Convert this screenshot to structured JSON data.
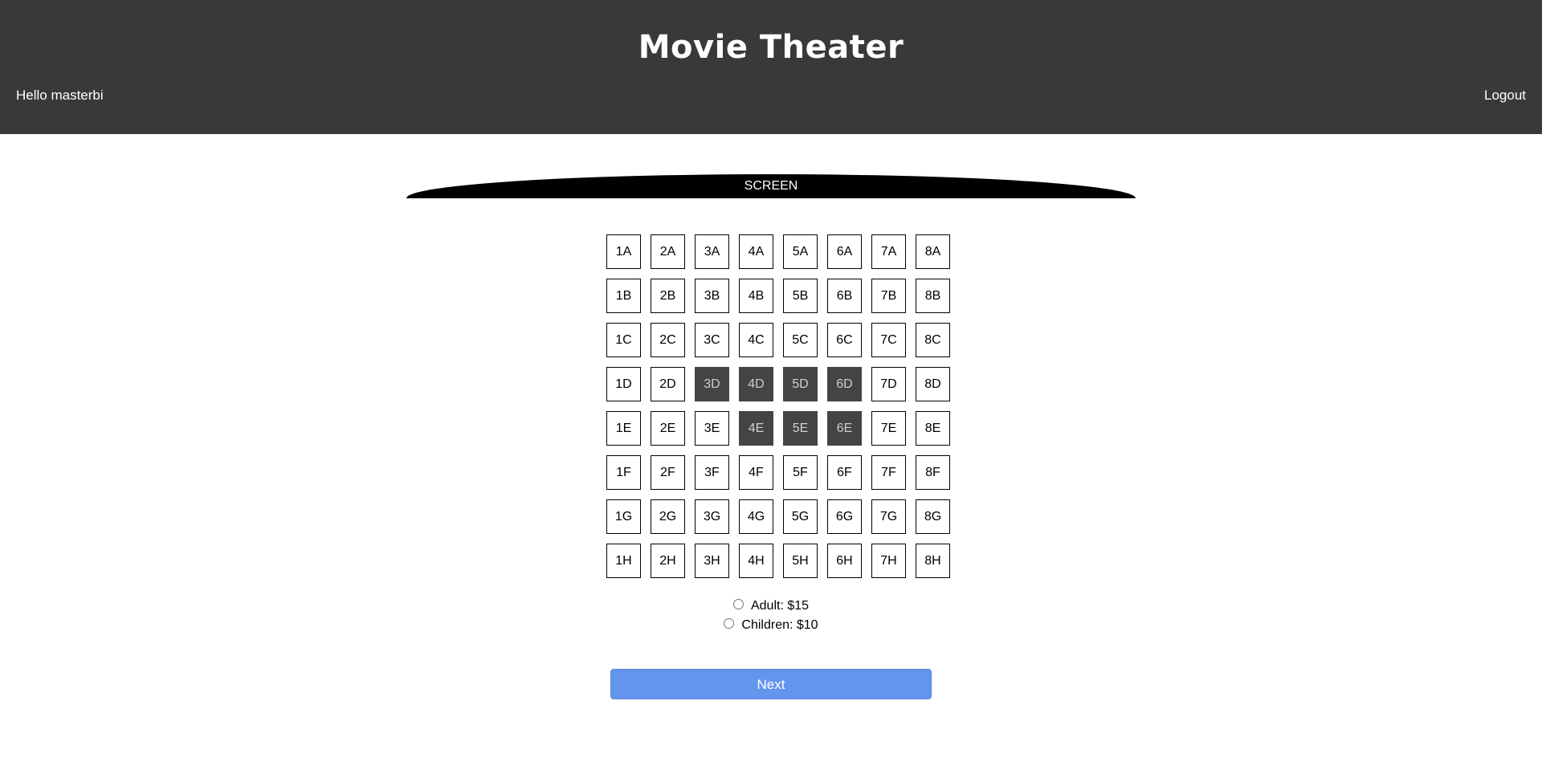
{
  "header": {
    "title": "Movie Theater",
    "greeting": "Hello masterbi",
    "logout_label": "Logout"
  },
  "screen_label": "SCREEN",
  "seats": [
    {
      "label": "1A",
      "taken": false
    },
    {
      "label": "2A",
      "taken": false
    },
    {
      "label": "3A",
      "taken": false
    },
    {
      "label": "4A",
      "taken": false
    },
    {
      "label": "5A",
      "taken": false
    },
    {
      "label": "6A",
      "taken": false
    },
    {
      "label": "7A",
      "taken": false
    },
    {
      "label": "8A",
      "taken": false
    },
    {
      "label": "1B",
      "taken": false
    },
    {
      "label": "2B",
      "taken": false
    },
    {
      "label": "3B",
      "taken": false
    },
    {
      "label": "4B",
      "taken": false
    },
    {
      "label": "5B",
      "taken": false
    },
    {
      "label": "6B",
      "taken": false
    },
    {
      "label": "7B",
      "taken": false
    },
    {
      "label": "8B",
      "taken": false
    },
    {
      "label": "1C",
      "taken": false
    },
    {
      "label": "2C",
      "taken": false
    },
    {
      "label": "3C",
      "taken": false
    },
    {
      "label": "4C",
      "taken": false
    },
    {
      "label": "5C",
      "taken": false
    },
    {
      "label": "6C",
      "taken": false
    },
    {
      "label": "7C",
      "taken": false
    },
    {
      "label": "8C",
      "taken": false
    },
    {
      "label": "1D",
      "taken": false
    },
    {
      "label": "2D",
      "taken": false
    },
    {
      "label": "3D",
      "taken": true
    },
    {
      "label": "4D",
      "taken": true
    },
    {
      "label": "5D",
      "taken": true
    },
    {
      "label": "6D",
      "taken": true
    },
    {
      "label": "7D",
      "taken": false
    },
    {
      "label": "8D",
      "taken": false
    },
    {
      "label": "1E",
      "taken": false
    },
    {
      "label": "2E",
      "taken": false
    },
    {
      "label": "3E",
      "taken": false
    },
    {
      "label": "4E",
      "taken": true
    },
    {
      "label": "5E",
      "taken": true
    },
    {
      "label": "6E",
      "taken": true
    },
    {
      "label": "7E",
      "taken": false
    },
    {
      "label": "8E",
      "taken": false
    },
    {
      "label": "1F",
      "taken": false
    },
    {
      "label": "2F",
      "taken": false
    },
    {
      "label": "3F",
      "taken": false
    },
    {
      "label": "4F",
      "taken": false
    },
    {
      "label": "5F",
      "taken": false
    },
    {
      "label": "6F",
      "taken": false
    },
    {
      "label": "7F",
      "taken": false
    },
    {
      "label": "8F",
      "taken": false
    },
    {
      "label": "1G",
      "taken": false
    },
    {
      "label": "2G",
      "taken": false
    },
    {
      "label": "3G",
      "taken": false
    },
    {
      "label": "4G",
      "taken": false
    },
    {
      "label": "5G",
      "taken": false
    },
    {
      "label": "6G",
      "taken": false
    },
    {
      "label": "7G",
      "taken": false
    },
    {
      "label": "8G",
      "taken": false
    },
    {
      "label": "1H",
      "taken": false
    },
    {
      "label": "2H",
      "taken": false
    },
    {
      "label": "3H",
      "taken": false
    },
    {
      "label": "4H",
      "taken": false
    },
    {
      "label": "5H",
      "taken": false
    },
    {
      "label": "6H",
      "taken": false
    },
    {
      "label": "7H",
      "taken": false
    },
    {
      "label": "8H",
      "taken": false
    }
  ],
  "ticket_options": [
    {
      "label": "Adult: $15",
      "checked": false
    },
    {
      "label": "Children: $10",
      "checked": false
    }
  ],
  "next_label": "Next",
  "colors": {
    "header_bg": "#393939",
    "taken_seat": "#444444",
    "next_button": "#6495ed"
  }
}
